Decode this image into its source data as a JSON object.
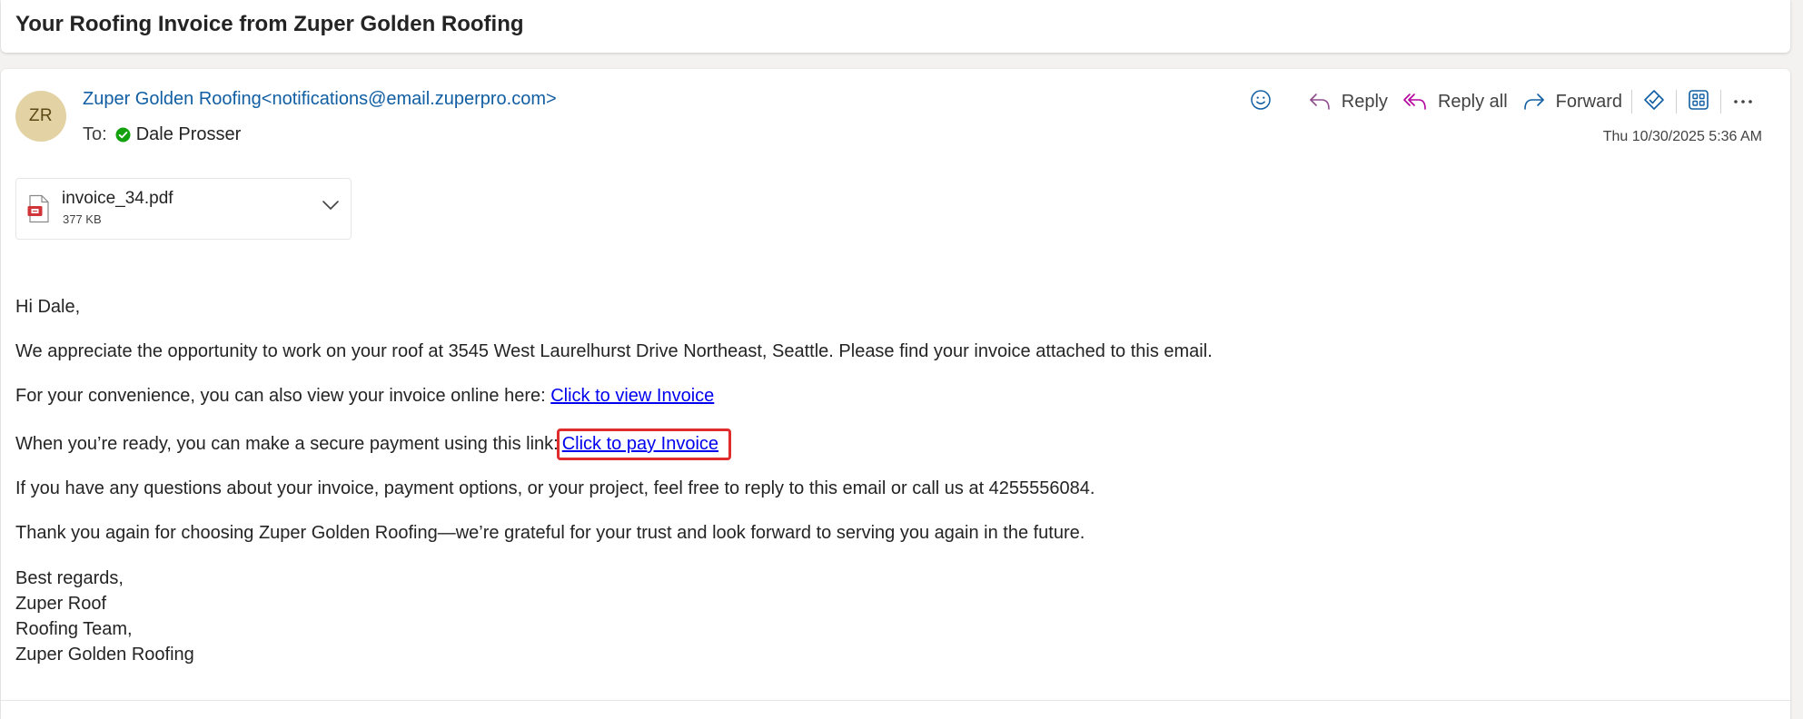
{
  "subject": "Your Roofing Invoice from Zuper Golden Roofing",
  "message": {
    "avatar_initials": "ZR",
    "sender": "Zuper Golden Roofing<notifications@email.zuperpro.com>",
    "to_label": "To:",
    "recipient": "Dale Prosser",
    "date": "Thu 10/30/2025 5:36 AM",
    "actions": {
      "reply": "Reply",
      "reply_all": "Reply all",
      "forward": "Forward"
    },
    "attachment": {
      "name": "invoice_34.pdf",
      "size": "377 KB"
    }
  },
  "body": {
    "greeting": "Hi Dale,",
    "para1": "We appreciate the opportunity to work on your roof at 3545 West Laurelhurst Drive Northeast, Seattle. Please find your invoice attached to this email.",
    "para2_text": "For your convenience, you can also view your invoice online here: ",
    "view_link": "Click to view Invoice",
    "para3_text": "When you’re ready, you can make a secure payment using this link:",
    "pay_link": "Click to pay Invoice",
    "para4": "If you have any questions about your invoice, payment options, or your project, feel free to reply to this email or call us at 4255556084.",
    "para5": "Thank you again for choosing Zuper Golden Roofing—we’re grateful for your trust and look forward to serving you again in the future.",
    "signature": [
      "Best regards,",
      "Zuper Roof",
      "Roofing Team,",
      "Zuper Golden Roofing"
    ]
  },
  "colors": {
    "sender_link": "#115ea3",
    "body_link": "#0000ee",
    "highlight_box": "#e02c2c",
    "avatar_bg": "#e2d2a4",
    "reply_all_icon": "#b4009e",
    "verified_green": "#13a10e"
  },
  "icons": [
    "emoji-icon",
    "reply-icon",
    "reply-all-icon",
    "forward-icon",
    "immersive-reader-icon",
    "apps-icon",
    "more-icon",
    "pdf-icon",
    "chevron-down-icon",
    "check-circle-icon"
  ]
}
